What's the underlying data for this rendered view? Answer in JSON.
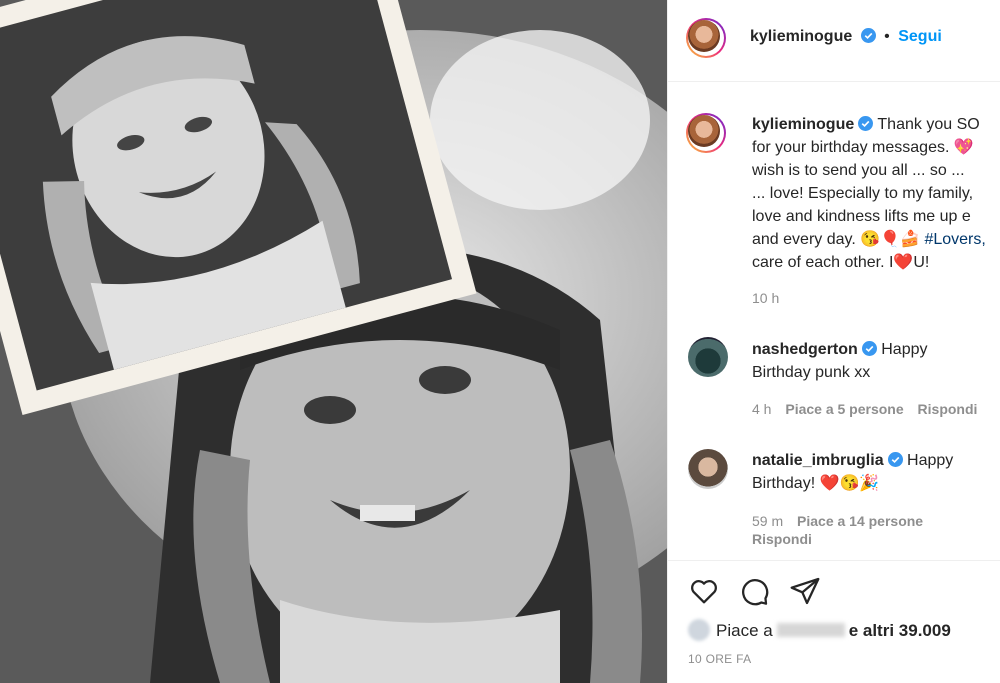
{
  "post": {
    "username": "kylieminogue",
    "follow_label": "Segui",
    "separator": "•"
  },
  "caption": {
    "username": "kylieminogue",
    "lines": [
      "Thank you SO",
      "for your birthday messages. 💖",
      "wish is to send you all ... so ...",
      "... love! Especially to my family,",
      "love and kindness lifts me up e",
      "and every day. 😘🎈🍰",
      "care of each other. I❤️U!"
    ],
    "hashtag": "#Lovers,",
    "time": "10 h"
  },
  "comments": [
    {
      "username": "nashedgerton",
      "text_first": "Happy",
      "text_rest": "Birthday punk xx",
      "time": "4 h",
      "likes": "Piace a 5 persone",
      "reply": "Rispondi"
    },
    {
      "username": "natalie_imbruglia",
      "text_first": "Happy",
      "text_rest": "Birthday! ❤️😘🎉",
      "time": "59 m",
      "likes": "Piace a 14 persone",
      "reply": "Rispondi"
    }
  ],
  "actions": {
    "icons": [
      "heart-icon",
      "comment-icon",
      "share-icon"
    ]
  },
  "likes": {
    "prefix": "Piace a",
    "suffix": "e altri 39.009"
  },
  "posted_ago": "10 ORE FA",
  "colors": {
    "link": "#0095f6",
    "hashtag": "#00376b",
    "muted": "#8e8e8e",
    "verified": "#3897f0"
  }
}
